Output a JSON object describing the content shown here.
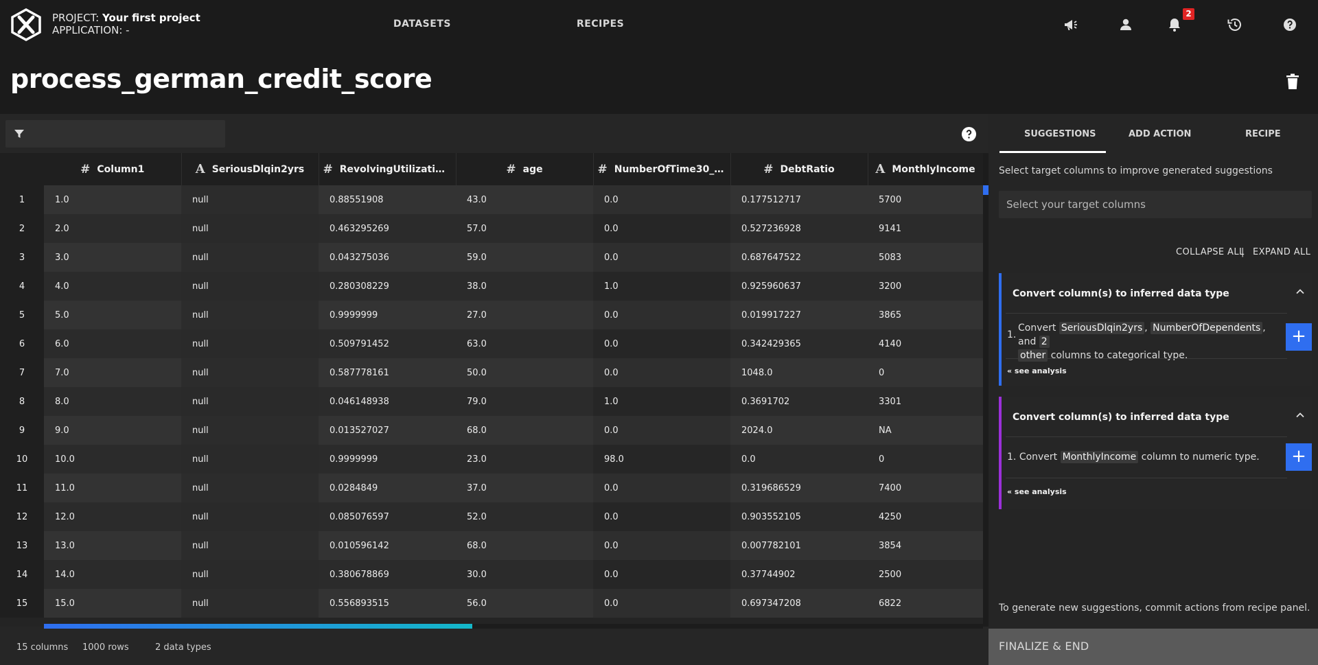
{
  "header": {
    "project_label": "PROJECT:",
    "project_name": "Your first project",
    "application_label": "APPLICATION:",
    "application_name": "-",
    "nav": [
      "DATASETS",
      "RECIPES"
    ],
    "notification_count": "2",
    "icons": [
      "logo-icon",
      "megaphone-icon",
      "user-icon",
      "bell-icon",
      "history-icon",
      "help-icon"
    ]
  },
  "page": {
    "title": "process_german_credit_score"
  },
  "table": {
    "columns": [
      {
        "type": "#",
        "name": "Column1"
      },
      {
        "type": "A",
        "name": "SeriousDlqin2yrs"
      },
      {
        "type": "#",
        "name": "RevolvingUtilizatio..."
      },
      {
        "type": "#",
        "name": "age"
      },
      {
        "type": "#",
        "name": "NumberOfTime30_5..."
      },
      {
        "type": "#",
        "name": "DebtRatio"
      },
      {
        "type": "A",
        "name": "MonthlyIncome"
      }
    ],
    "rows": [
      [
        "1",
        "1.0",
        "null",
        "0.88551908",
        "43.0",
        "0.0",
        "0.177512717",
        "5700"
      ],
      [
        "2",
        "2.0",
        "null",
        "0.463295269",
        "57.0",
        "0.0",
        "0.527236928",
        "9141"
      ],
      [
        "3",
        "3.0",
        "null",
        "0.043275036",
        "59.0",
        "0.0",
        "0.687647522",
        "5083"
      ],
      [
        "4",
        "4.0",
        "null",
        "0.280308229",
        "38.0",
        "1.0",
        "0.925960637",
        "3200"
      ],
      [
        "5",
        "5.0",
        "null",
        "0.9999999",
        "27.0",
        "0.0",
        "0.019917227",
        "3865"
      ],
      [
        "6",
        "6.0",
        "null",
        "0.509791452",
        "63.0",
        "0.0",
        "0.342429365",
        "4140"
      ],
      [
        "7",
        "7.0",
        "null",
        "0.587778161",
        "50.0",
        "0.0",
        "1048.0",
        "0"
      ],
      [
        "8",
        "8.0",
        "null",
        "0.046148938",
        "79.0",
        "1.0",
        "0.3691702",
        "3301"
      ],
      [
        "9",
        "9.0",
        "null",
        "0.013527027",
        "68.0",
        "0.0",
        "2024.0",
        "NA"
      ],
      [
        "10",
        "10.0",
        "null",
        "0.9999999",
        "23.0",
        "98.0",
        "0.0",
        "0"
      ],
      [
        "11",
        "11.0",
        "null",
        "0.0284849",
        "37.0",
        "0.0",
        "0.319686529",
        "7400"
      ],
      [
        "12",
        "12.0",
        "null",
        "0.085076597",
        "52.0",
        "0.0",
        "0.903552105",
        "4250"
      ],
      [
        "13",
        "13.0",
        "null",
        "0.010596142",
        "68.0",
        "0.0",
        "0.007782101",
        "3854"
      ],
      [
        "14",
        "14.0",
        "null",
        "0.380678869",
        "30.0",
        "0.0",
        "0.37744902",
        "2500"
      ],
      [
        "15",
        "15.0",
        "null",
        "0.556893515",
        "56.0",
        "0.0",
        "0.697347208",
        "6822"
      ]
    ]
  },
  "status": {
    "columns": "15 columns",
    "rows": "1000 rows",
    "types": "2 data types"
  },
  "panel": {
    "tabs": [
      "SUGGESTIONS",
      "ADD ACTION",
      "RECIPE"
    ],
    "active_tab": "SUGGESTIONS",
    "hint": "Select target columns to improve generated suggestions",
    "target_placeholder": "Select your target columns",
    "collapse_all": "COLLAPSE ALL",
    "separator": "|",
    "expand_all": "EXPAND ALL",
    "cards": [
      {
        "accent": "#2f6ef0",
        "title": "Convert column(s) to inferred data type",
        "num": "1.",
        "w_convert": "Convert",
        "tag1": "SeriousDlqin2yrs",
        "comma": ",",
        "tag2": "NumberOfDependents",
        "and": ", and",
        "tag3a": "2",
        "tag3b": "other",
        "tail": "columns to categorical type.",
        "see": "« see analysis"
      },
      {
        "accent": "#9b30d9",
        "title": "Convert column(s) to inferred data type",
        "num": "1.",
        "w_convert": "Convert",
        "tag1": "MonthlyIncome",
        "tail": "column to numeric type.",
        "see": "« see analysis"
      }
    ],
    "footer_hint": "To generate new suggestions, commit actions from recipe panel.",
    "finalize": "FINALIZE & END"
  },
  "colors": {
    "accent_blue": "#2f6ef0",
    "accent_purple": "#9b30d9",
    "badge_red": "#e02424"
  }
}
